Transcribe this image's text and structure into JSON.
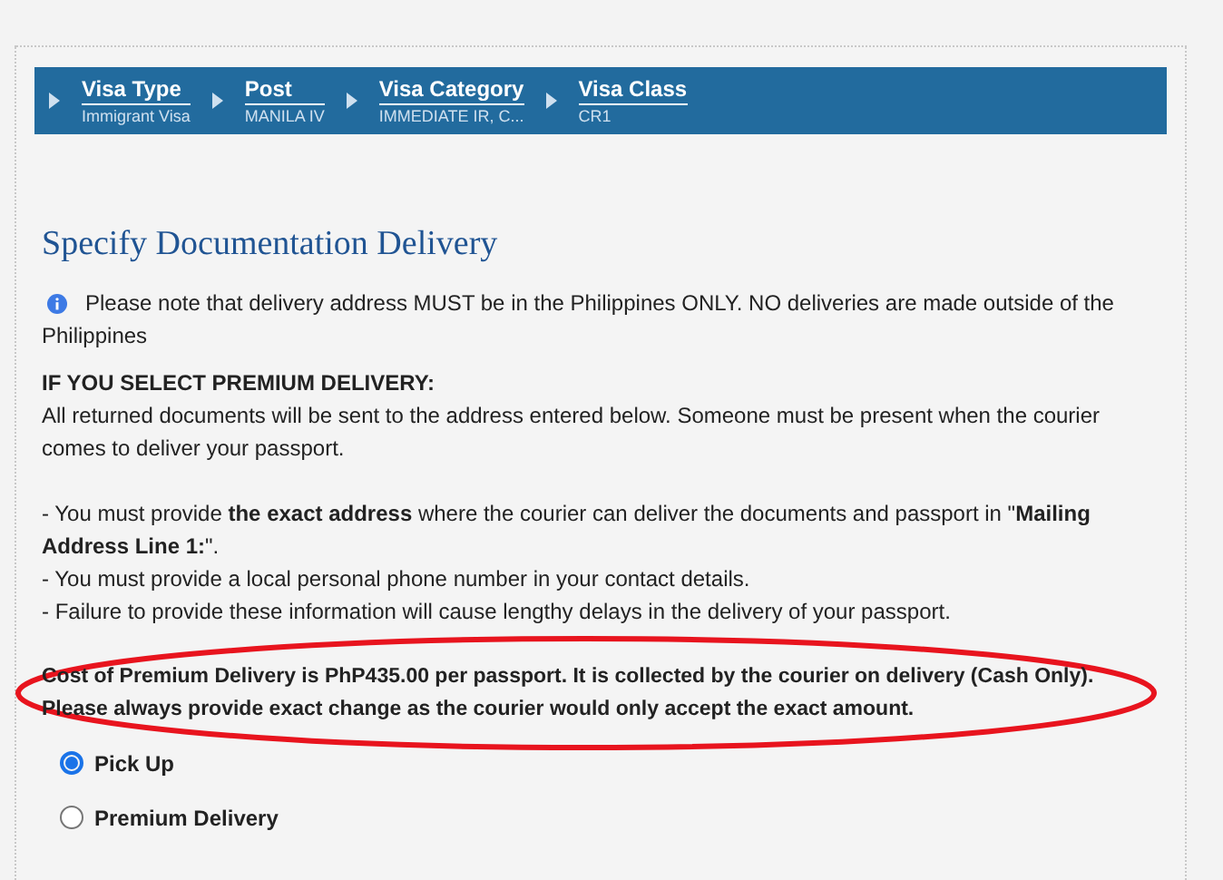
{
  "breadcrumbs": [
    {
      "label": "Visa Type",
      "value": "Immigrant Visa"
    },
    {
      "label": "Post",
      "value": "MANILA IV"
    },
    {
      "label": "Visa Category",
      "value": "IMMEDIATE IR, C..."
    },
    {
      "label": "Visa Class",
      "value": "CR1"
    }
  ],
  "heading": "Specify Documentation Delivery",
  "notice": "Please note that delivery address MUST be in the Philippines ONLY.  NO deliveries are made outside of the Philippines",
  "premium_title": "IF YOU SELECT PREMIUM DELIVERY:",
  "premium_text": "All returned documents will be sent to the address entered below.  Someone must be present when the courier comes to deliver your passport.",
  "requirements": [
    "- You must provide **the exact address** where the courier can deliver the documents and passport in \"**Mailing Address Line 1:**\".",
    "- You must provide a local personal phone number in your contact details.",
    "- Failure to provide these information will cause lengthy delays in the delivery of your passport."
  ],
  "cost_notice": [
    "Cost of Premium Delivery is PhP435.00 per passport. It is collected by the courier on delivery (Cash Only).",
    "Please always provide exact change as the courier would only accept the exact amount."
  ],
  "options": [
    {
      "label": "Pick Up",
      "selected": true
    },
    {
      "label": "Premium Delivery",
      "selected": false
    }
  ]
}
